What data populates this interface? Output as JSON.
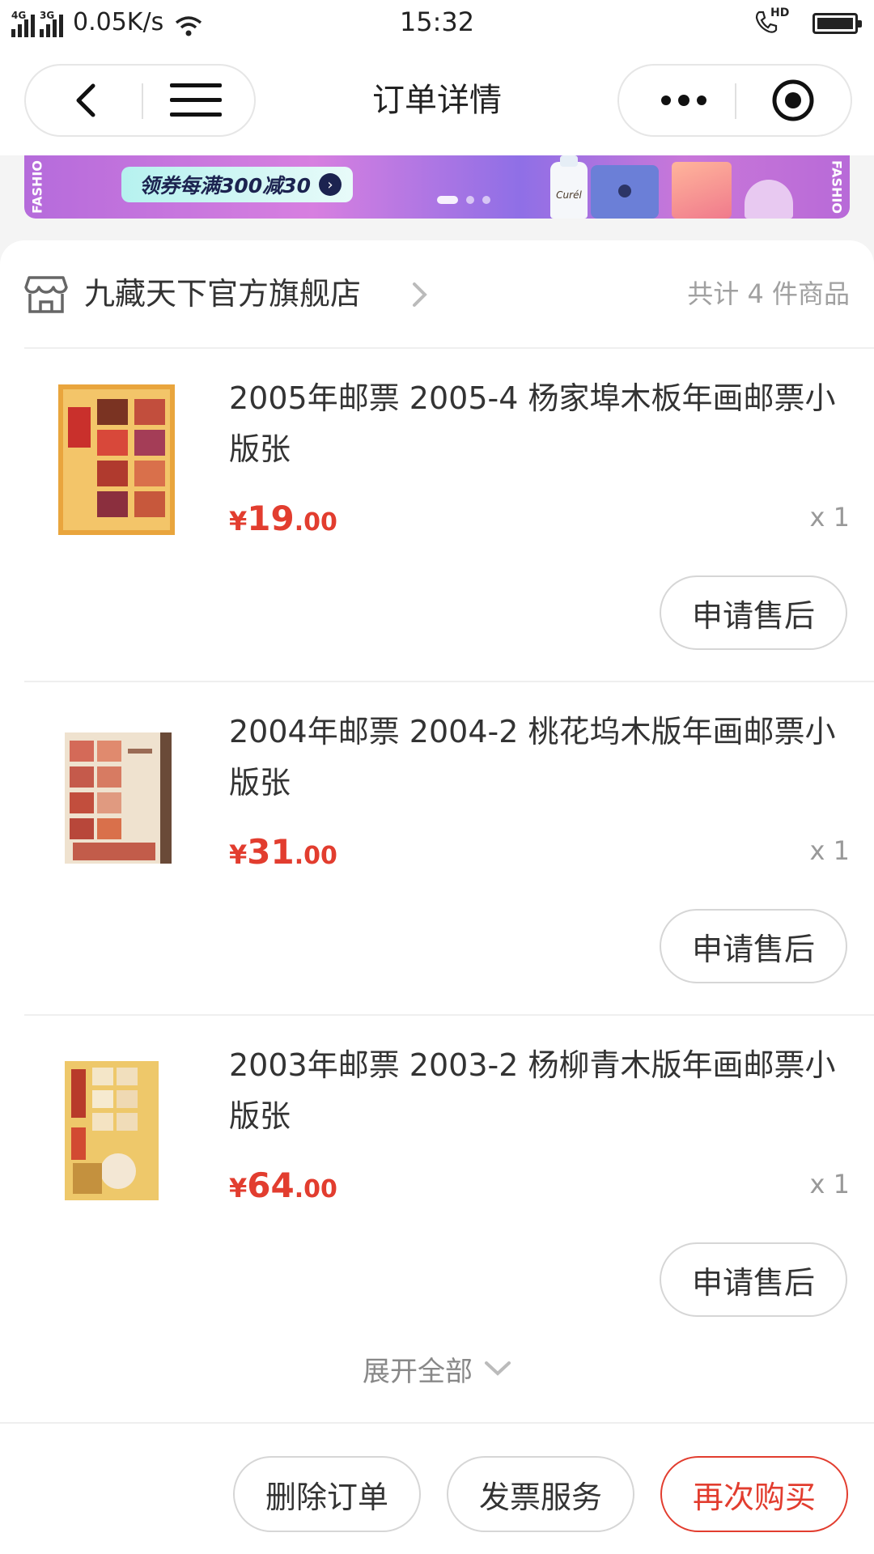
{
  "status_bar": {
    "network_1": "4G",
    "network_2": "3G",
    "speed": "0.05K/s",
    "time": "15:32",
    "call_badge": "HD"
  },
  "header": {
    "title": "订单详情"
  },
  "banner": {
    "side_text": "FASHIO",
    "promo_text": "领券每满300减30",
    "bottle_label": "Curél"
  },
  "order": {
    "store_name": "九藏天下官方旗舰店",
    "item_count": "共计 4 件商品",
    "products": [
      {
        "title": "2005年邮票 2005-4 杨家埠木板年画邮票小版张",
        "price_symbol": "¥",
        "price_int": "19",
        "price_dec": ".00",
        "quantity": "x 1",
        "after_sale_label": "申请售后"
      },
      {
        "title": "2004年邮票 2004-2 桃花坞木版年画邮票小版张",
        "price_symbol": "¥",
        "price_int": "31",
        "price_dec": ".00",
        "quantity": "x 1",
        "after_sale_label": "申请售后"
      },
      {
        "title": "2003年邮票 2003-2 杨柳青木版年画邮票小版张",
        "price_symbol": "¥",
        "price_int": "64",
        "price_dec": ".00",
        "quantity": "x 1",
        "after_sale_label": "申请售后"
      }
    ],
    "expand_label": "展开全部"
  },
  "bottom_bar": {
    "delete_label": "删除订单",
    "invoice_label": "发票服务",
    "rebuy_label": "再次购买"
  },
  "colors": {
    "price_red": "#e23d2f",
    "text_dark": "#333333",
    "text_gray": "#999999",
    "border_gray": "#d6d6d6",
    "banner_purple": "#b56bdb"
  },
  "icons": [
    "back-icon",
    "menu-icon",
    "more-icon",
    "target-icon",
    "store-icon",
    "chevron-right-icon",
    "chevron-down-icon",
    "wifi-icon",
    "phone-hd-icon",
    "battery-icon"
  ]
}
